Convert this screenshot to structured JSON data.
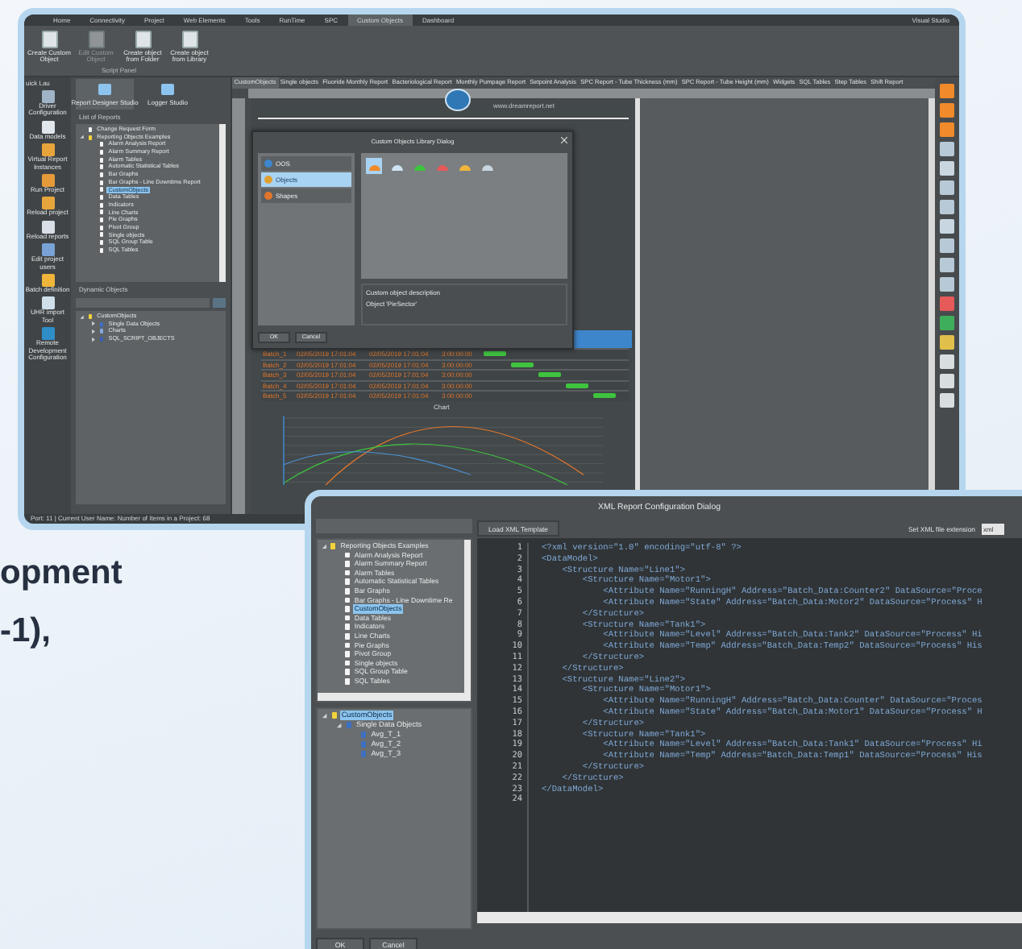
{
  "backdrop_text": [
    "opment",
    "-1),"
  ],
  "main_window": {
    "menu": [
      {
        "label": "Home",
        "selected": false
      },
      {
        "label": "Connectivity",
        "selected": false
      },
      {
        "label": "Project",
        "selected": false
      },
      {
        "label": "Web Elements",
        "selected": false
      },
      {
        "label": "Tools",
        "selected": false
      },
      {
        "label": "RunTime",
        "selected": false
      },
      {
        "label": "SPC",
        "selected": false
      },
      {
        "label": "Custom Objects",
        "selected": true
      },
      {
        "label": "Dashboard",
        "selected": false
      }
    ],
    "menu_right": "Visual Studio",
    "ribbon": {
      "buttons": [
        {
          "label": "Create Custom Object",
          "disabled": false
        },
        {
          "label": "Edit Custom Object",
          "disabled": true
        },
        {
          "label": "Create object from Folder",
          "disabled": false
        },
        {
          "label": "Create object from Library",
          "disabled": false
        }
      ],
      "group": "Script Panel"
    },
    "quick_launch": "uick Lau",
    "side_tools": [
      "Driver Configuration",
      "Data models",
      "Virtual Report Instances",
      "Run Project",
      "Reload project",
      "Reload reports",
      "Edit project users",
      "Batch definition",
      "UHR import Tool",
      "Remote Development Configuration"
    ],
    "studio_tabs": [
      {
        "label": "Report Designer Studio",
        "selected": true
      },
      {
        "label": "Logger Studio",
        "selected": false
      }
    ],
    "reports": {
      "title": "List of Reports",
      "items": [
        {
          "label": "Change Request Form",
          "kind": "file",
          "selected": false
        },
        {
          "label": "Reporting Objects Examples",
          "kind": "folder",
          "selected": false,
          "expanded": true,
          "children": [
            {
              "label": "Alarm Analysis Report",
              "kind": "file",
              "selected": false
            },
            {
              "label": "Alarm Summary Report",
              "kind": "file",
              "selected": false
            },
            {
              "label": "Alarm Tables",
              "kind": "file",
              "selected": false
            },
            {
              "label": "Automatic Statistical Tables",
              "kind": "file",
              "selected": false
            },
            {
              "label": "Bar Graphs",
              "kind": "file",
              "selected": false
            },
            {
              "label": "Bar Graphs - Line Downtime Report",
              "kind": "file",
              "selected": false
            },
            {
              "label": "CustomObjects",
              "kind": "file",
              "selected": true
            },
            {
              "label": "Data Tables",
              "kind": "file",
              "selected": false
            },
            {
              "label": "Indicators",
              "kind": "file",
              "selected": false
            },
            {
              "label": "Line Charts",
              "kind": "file",
              "selected": false
            },
            {
              "label": "Pie Graphs",
              "kind": "file",
              "selected": false
            },
            {
              "label": "Pivot Group",
              "kind": "file",
              "selected": false
            },
            {
              "label": "Single objects",
              "kind": "file",
              "selected": false
            },
            {
              "label": "SQL Group Table",
              "kind": "file",
              "selected": false
            },
            {
              "label": "SQL Tables",
              "kind": "file",
              "selected": false
            }
          ]
        }
      ]
    },
    "dynamic_objects": {
      "title": "Dynamic Objects",
      "items": [
        {
          "label": "CustomObjects",
          "kind": "folder",
          "selected": false,
          "expanded": true,
          "children": [
            {
              "label": "Single Data Objects",
              "kind": "data",
              "selected": false,
              "expanded": false
            },
            {
              "label": "Charts",
              "kind": "chart",
              "selected": false,
              "expanded": false
            },
            {
              "label": "SQL_SCRIPT_OBJECTS",
              "kind": "script",
              "selected": false,
              "expanded": false
            }
          ]
        }
      ]
    },
    "doc_tabs": [
      {
        "label": "CustomObjects",
        "selected": true
      },
      {
        "label": "Single objects",
        "selected": false
      },
      {
        "label": "Fluoride Monthly Report",
        "selected": false
      },
      {
        "label": "Bacteriological Report",
        "selected": false
      },
      {
        "label": "Monthly Pumpage Report",
        "selected": false
      },
      {
        "label": "Setpoint Analysis",
        "selected": false
      },
      {
        "label": "SPC Report - Tube Thickness (mm)",
        "selected": false
      },
      {
        "label": "SPC Report - Tube Height (mm)",
        "selected": false
      },
      {
        "label": "Widgets",
        "selected": false
      },
      {
        "label": "SQL Tables",
        "selected": false
      },
      {
        "label": "Step Tables",
        "selected": false
      },
      {
        "label": "Shift Report",
        "selected": false
      }
    ],
    "page_url": "www.dreamreport.net",
    "library_dialog": {
      "title": "Custom Objects Library Dialog",
      "categories": [
        {
          "label": "OOS",
          "selected": false
        },
        {
          "label": "Objects",
          "selected": true
        },
        {
          "label": "Shapes",
          "selected": false
        }
      ],
      "description_label": "Custom object description",
      "description": "Object 'PieSector'",
      "buttons": [
        "OK",
        "Cancel"
      ]
    },
    "table_rows": [
      [
        "Batch_1",
        "02/05/2019 17:01:04",
        "02/05/2019 17:01:04",
        "3:00:00:00"
      ],
      [
        "Batch_2",
        "02/05/2019 17:01:04",
        "02/05/2019 17:01:04",
        "3:00:00:00"
      ],
      [
        "Batch_3",
        "02/05/2019 17:01:04",
        "02/05/2019 17:01:04",
        "3:00:00:00"
      ],
      [
        "Batch_4",
        "02/05/2019 17:01:04",
        "02/05/2019 17:01:04",
        "3:00:00:00"
      ],
      [
        "Batch_5",
        "02/05/2019 17:01:04",
        "02/05/2019 17:01:04",
        "3:00:00:00"
      ]
    ],
    "chart_title": "Chart",
    "status": "Port: 11 | Current User Name: Number of Items in a Project: 68"
  },
  "xml_dialog": {
    "title": "XML Report Configuration Dialog",
    "tree": [
      {
        "label": "Reporting Objects Examples",
        "kind": "folder",
        "selected": false,
        "expanded": true,
        "children": [
          {
            "label": "Alarm Analysis Report",
            "kind": "file",
            "selected": false
          },
          {
            "label": "Alarm Summary Report",
            "kind": "file",
            "selected": false
          },
          {
            "label": "Alarm Tables",
            "kind": "file",
            "selected": false
          },
          {
            "label": "Automatic Statistical Tables",
            "kind": "file",
            "selected": false
          },
          {
            "label": "Bar Graphs",
            "kind": "file",
            "selected": false
          },
          {
            "label": "Bar Graphs - Line Downtime Re",
            "kind": "file",
            "selected": false
          },
          {
            "label": "CustomObjects",
            "kind": "file",
            "selected": true
          },
          {
            "label": "Data Tables",
            "kind": "file",
            "selected": false
          },
          {
            "label": "Indicators",
            "kind": "file",
            "selected": false
          },
          {
            "label": "Line Charts",
            "kind": "file",
            "selected": false
          },
          {
            "label": "Pie Graphs",
            "kind": "file",
            "selected": false
          },
          {
            "label": "Pivot Group",
            "kind": "file",
            "selected": false
          },
          {
            "label": "Single objects",
            "kind": "file",
            "selected": false
          },
          {
            "label": "SQL Group Table",
            "kind": "file",
            "selected": false
          },
          {
            "label": "SQL Tables",
            "kind": "file",
            "selected": false
          }
        ]
      }
    ],
    "objects": [
      {
        "label": "CustomObjects",
        "kind": "folder",
        "selected": true,
        "expanded": true,
        "children": [
          {
            "label": "Single Data Objects",
            "kind": "data",
            "selected": false,
            "expanded": true,
            "children": [
              {
                "label": "Avg_T_1",
                "kind": "data",
                "selected": false
              },
              {
                "label": "Avg_T_2",
                "kind": "data",
                "selected": false
              },
              {
                "label": "Avg_T_3",
                "kind": "data",
                "selected": false
              }
            ]
          }
        ]
      }
    ],
    "load_button": "Load XML Template",
    "extension_label": "Set XML file extension",
    "extension_value": "xml",
    "code_lines": [
      {
        "number": "1",
        "text": "<?xml version=\"1.0\" encoding=\"utf-8\" ?>"
      },
      {
        "number": "2",
        "text": "<DataModel>"
      },
      {
        "number": "3",
        "text": "    <Structure Name=\"Line1\">"
      },
      {
        "number": "4",
        "text": "        <Structure Name=\"Motor1\">"
      },
      {
        "number": "5",
        "text": "            <Attribute Name=\"RunningH\" Address=\"Batch_Data:Counter2\" DataSource=\"Proce"
      },
      {
        "number": "6",
        "text": "            <Attribute Name=\"State\" Address=\"Batch_Data:Motor2\" DataSource=\"Process\" H"
      },
      {
        "number": "7",
        "text": "        </Structure>"
      },
      {
        "number": "8",
        "text": "        <Structure Name=\"Tank1\">"
      },
      {
        "number": "9",
        "text": "            <Attribute Name=\"Level\" Address=\"Batch_Data:Tank2\" DataSource=\"Process\" Hi"
      },
      {
        "number": "10",
        "text": "            <Attribute Name=\"Temp\" Address=\"Batch_Data:Temp2\" DataSource=\"Process\" His"
      },
      {
        "number": "11",
        "text": "        </Structure>"
      },
      {
        "number": "12",
        "text": "    </Structure>"
      },
      {
        "number": "13",
        "text": "    <Structure Name=\"Line2\">"
      },
      {
        "number": "14",
        "text": "        <Structure Name=\"Motor1\">"
      },
      {
        "number": "15",
        "text": "            <Attribute Name=\"RunningH\" Address=\"Batch_Data:Counter\" DataSource=\"Proces"
      },
      {
        "number": "16",
        "text": "            <Attribute Name=\"State\" Address=\"Batch_Data:Motor1\" DataSource=\"Process\" H"
      },
      {
        "number": "17",
        "text": "        </Structure>"
      },
      {
        "number": "18",
        "text": "        <Structure Name=\"Tank1\">"
      },
      {
        "number": "19",
        "text": "            <Attribute Name=\"Level\" Address=\"Batch_Data:Tank1\" DataSource=\"Process\" Hi"
      },
      {
        "number": "20",
        "text": "            <Attribute Name=\"Temp\" Address=\"Batch_Data:Temp1\" DataSource=\"Process\" His"
      },
      {
        "number": "21",
        "text": "        </Structure>"
      },
      {
        "number": "22",
        "text": "    </Structure>"
      },
      {
        "number": "23",
        "text": "</DataModel>"
      },
      {
        "number": "24"
      }
    ],
    "buttons": [
      "OK",
      "Cancel"
    ]
  }
}
